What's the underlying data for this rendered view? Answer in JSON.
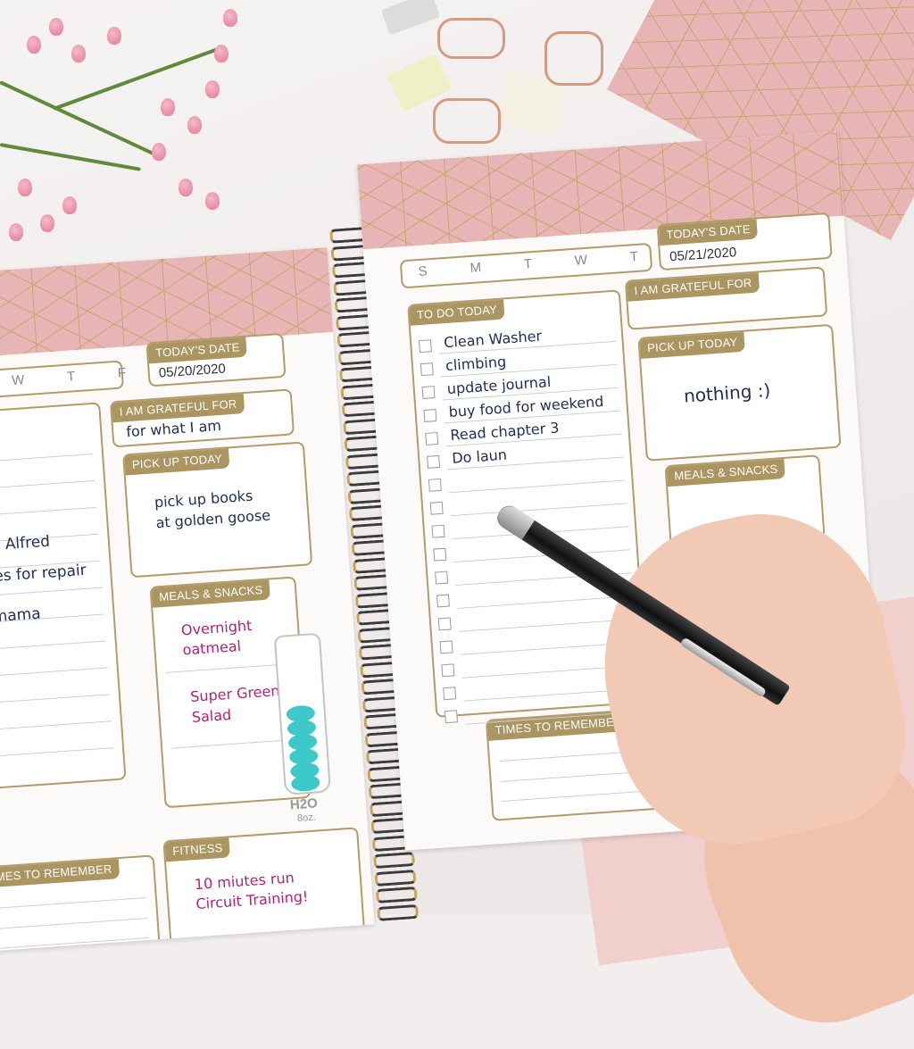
{
  "scene": "planner-photo",
  "colors": {
    "accent": "#ab9560",
    "pink_cover": "#e7b5b6",
    "ink_blue": "#1e2d55",
    "ink_pink": "#b51f77",
    "water": "#3dc8c9"
  },
  "left_page": {
    "weekdays": "T W T F S",
    "date_label": "TODAY'S DATE",
    "date_value": "05/20/2020",
    "grateful_label": "I AM GRATEFUL FOR",
    "grateful_text": "for what I am",
    "pickup_label": "PICK UP TODAY",
    "pickup_text": [
      "pick up books",
      "at golden goose"
    ],
    "todo_items": [
      "te to Alfred",
      "shoes for repair",
      "all mama"
    ],
    "meals_label": "MEALS & SNACKS",
    "meals": [
      "Overnight",
      "oatmeal",
      "Super Greens",
      "Salad"
    ],
    "water_label": "H2O",
    "water_unit": "8oz.",
    "fitness_label": "FITNESS",
    "fitness_text": [
      "10 miutes run",
      "Circuit Training!"
    ],
    "times_label": "MES TO REMEMBER"
  },
  "right_page": {
    "weekdays": "S M T W T F S",
    "date_label": "TODAY'S DATE",
    "date_value": "05/21/2020",
    "todo_label": "TO DO TODAY",
    "todo_items": [
      "Clean Washer",
      "climbing",
      "update journal",
      "buy food for weekend",
      "Read chapter 3",
      "Do laun"
    ],
    "grateful_label": "I AM GRATEFUL FOR",
    "pickup_label": "PICK UP TODAY",
    "pickup_text": "nothing :)",
    "meals_label": "MEALS & SNACKS",
    "times_label": "TIMES TO REMEMBER"
  },
  "icons": [
    "flower-branch-icon",
    "binder-clip-icon",
    "pen-icon",
    "water-bottle-icon"
  ]
}
